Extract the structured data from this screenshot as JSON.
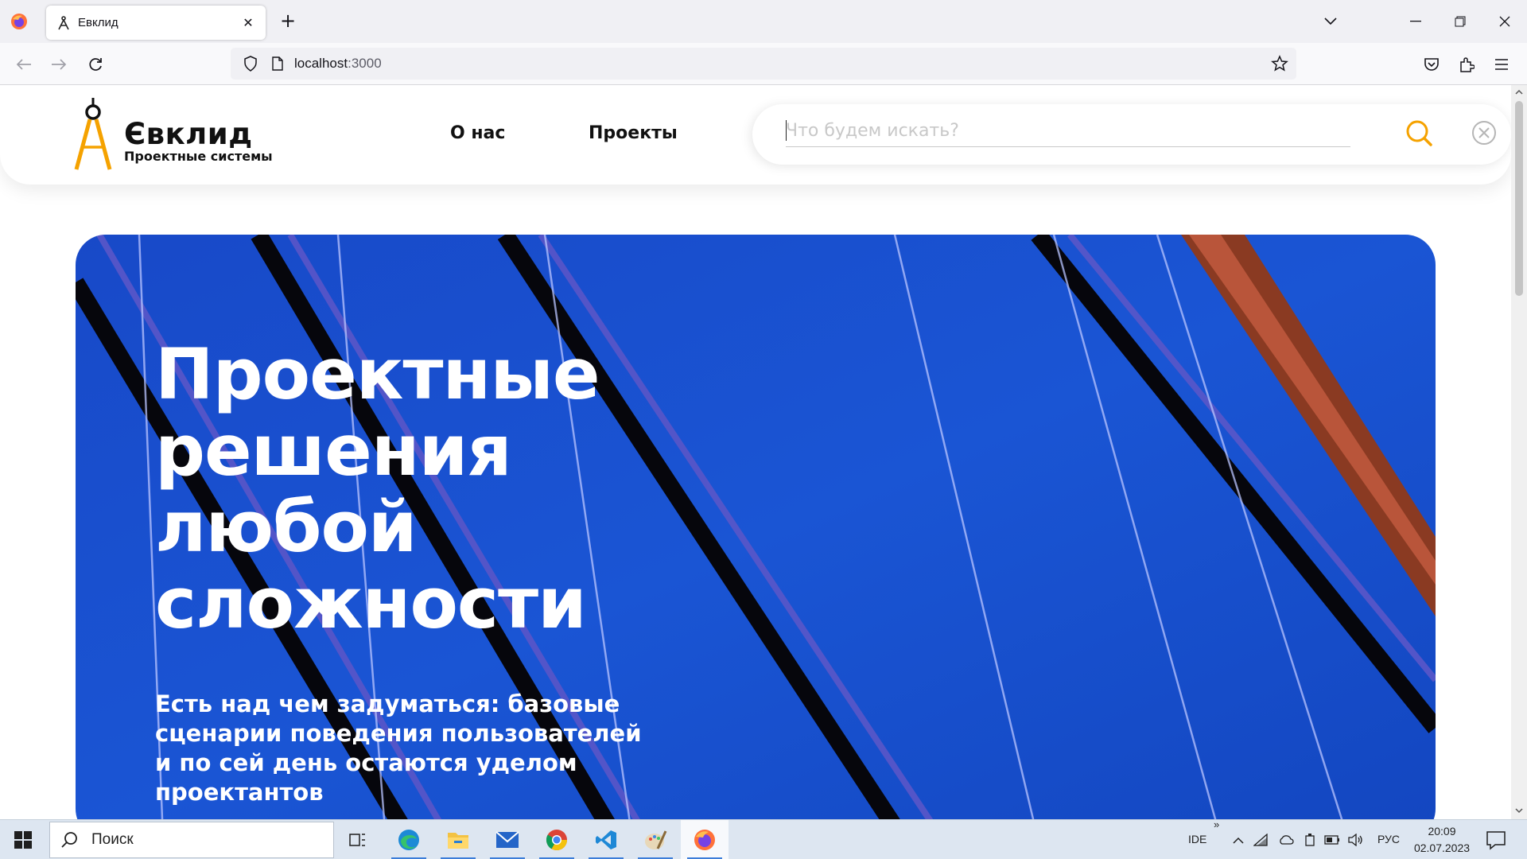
{
  "browser": {
    "tab_title": "Евклид",
    "url_host": "localhost",
    "url_port": ":3000"
  },
  "site": {
    "brand_name": "Євклид",
    "brand_tagline": "Проектные системы",
    "nav": [
      "О нас",
      "Проекты"
    ],
    "search_placeholder": "Что будем искать?",
    "accent_color": "#f5a200",
    "hero": {
      "title": "Проектные решения любой сложности",
      "subtitle": "Есть над чем задуматься: базовые сценарии поведения пользователей и по сей день остаются уделом проектантов"
    }
  },
  "taskbar": {
    "search_label": "Поиск",
    "lang_ide": "IDE",
    "lang": "РУС",
    "time": "20:09",
    "date": "02.07.2023",
    "apps": [
      "task-view",
      "edge",
      "file-explorer",
      "mail",
      "chrome",
      "vscode",
      "paint",
      "firefox"
    ]
  }
}
